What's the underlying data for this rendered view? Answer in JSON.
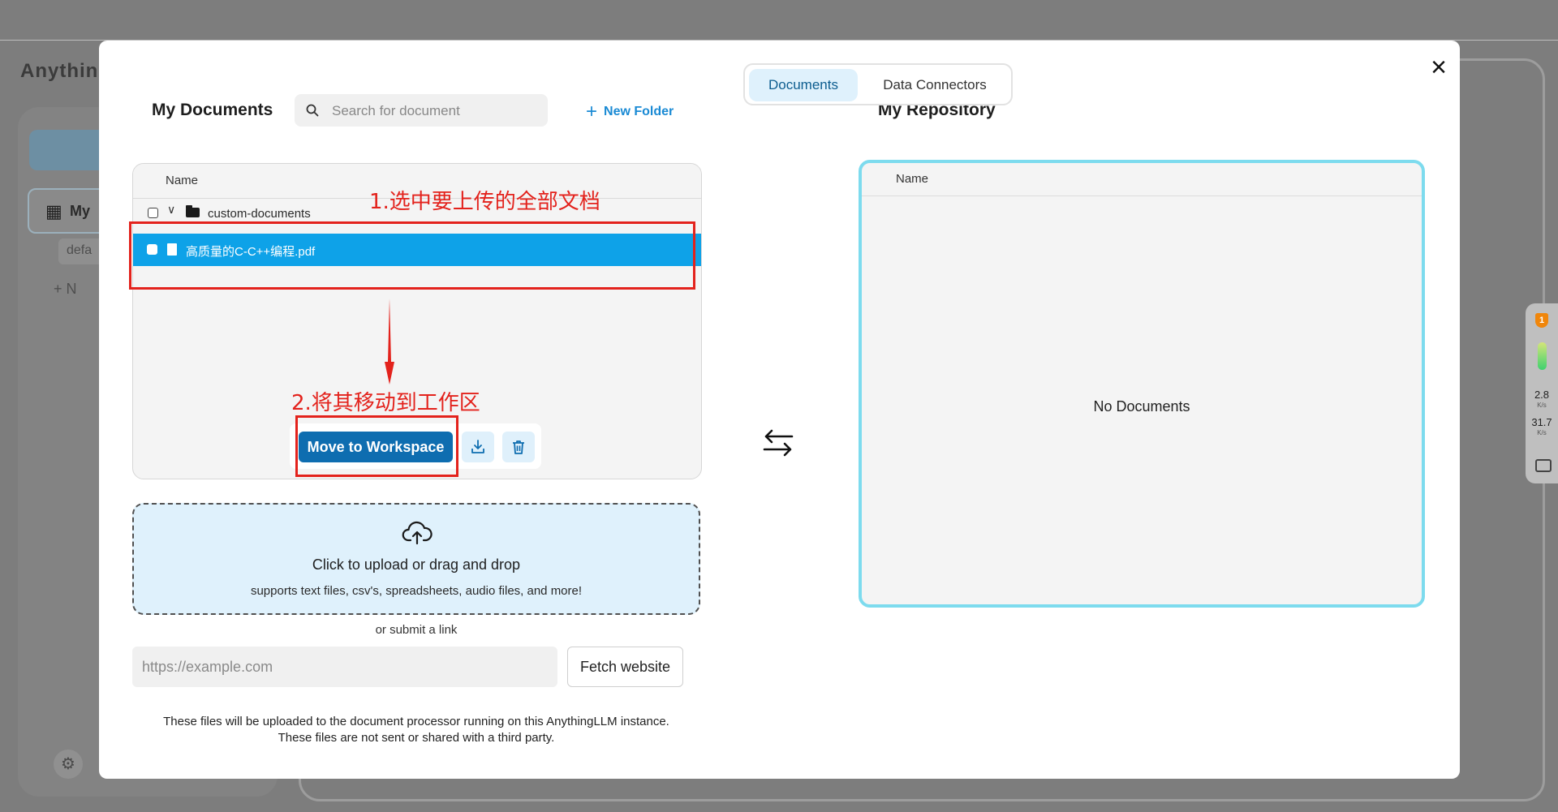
{
  "background": {
    "logo": "AnythingLLM",
    "sidebar_item_label": "My",
    "sidebar_sub_label": "defa",
    "sidebar_add_label": "+ N"
  },
  "extension": {
    "badge": "1",
    "speed_up": "2.8",
    "speed_up_unit": "K/s",
    "speed_down": "31.7",
    "speed_down_unit": "K/s"
  },
  "tabs": [
    {
      "label": "Documents",
      "active": true
    },
    {
      "label": "Data Connectors",
      "active": false
    }
  ],
  "my_documents": {
    "title": "My Documents",
    "search_placeholder": "Search for document",
    "new_folder_label": "New Folder",
    "column_name": "Name",
    "folder": {
      "name": "custom-documents",
      "expanded": true,
      "checked": false
    },
    "files": [
      {
        "name": "高质量的C-C++编程.pdf",
        "selected": true
      }
    ],
    "actions": {
      "move_label": "Move to Workspace",
      "embed_icon": "tray-download-icon",
      "delete_icon": "trash-icon"
    }
  },
  "repository": {
    "title": "My Repository",
    "column_name": "Name",
    "empty_text": "No Documents"
  },
  "upload": {
    "title": "Click to upload or drag and drop",
    "subtitle": "supports text files, csv's, spreadsheets, audio files, and more!",
    "or_link": "or submit a link",
    "url_placeholder": "https://example.com",
    "fetch_label": "Fetch website",
    "disclaimer_line1": "These files will be uploaded to the document processor running on this AnythingLLM instance.",
    "disclaimer_line2": "These files are not sent or shared with a third party."
  },
  "annotations": {
    "step1": "1.选中要上传的全部文档",
    "step2": "2.将其移动到工作区",
    "color": "#e3221c"
  },
  "colors": {
    "accent": "#0ea2e8",
    "primary_button": "#0e6db0",
    "repo_border": "#7ddbee"
  }
}
